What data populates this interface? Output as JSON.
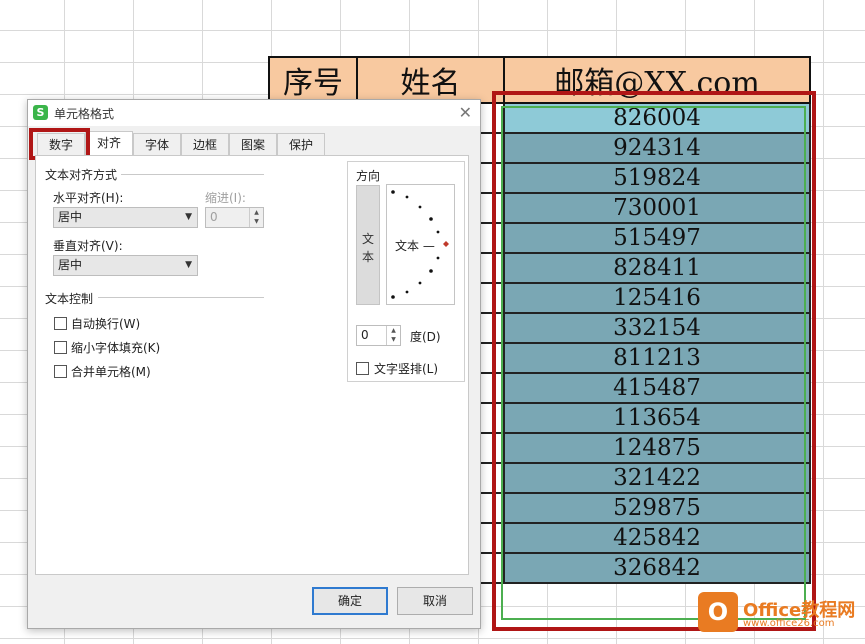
{
  "sheet": {
    "headers": [
      "序号",
      "姓名",
      "邮箱@XX.com"
    ],
    "emails": [
      "826004",
      "924314",
      "519824",
      "730001",
      "515497",
      "828411",
      "125416",
      "332154",
      "811213",
      "415487",
      "113654",
      "124875",
      "321422",
      "529875",
      "425842",
      "326842"
    ],
    "colors": {
      "header_fill": "#f8c9a0",
      "selected_fill": "#7aa7b4",
      "active_fill": "#8ecad7",
      "highlight_red": "#b01616",
      "selection_green": "#4caf50"
    }
  },
  "dialog": {
    "title": "单元格格式",
    "app_icon": "S",
    "tabs": [
      "数字",
      "对齐",
      "字体",
      "边框",
      "图案",
      "保护"
    ],
    "active_tab": "对齐",
    "alignment": {
      "section_label": "文本对齐方式",
      "horizontal_label": "水平对齐(H):",
      "horizontal_value": "居中",
      "indent_label": "缩进(I):",
      "indent_value": "0",
      "vertical_label": "垂直对齐(V):",
      "vertical_value": "居中"
    },
    "text_control": {
      "section_label": "文本控制",
      "options": [
        "自动换行(W)",
        "缩小字体填充(K)",
        "合并单元格(M)"
      ]
    },
    "orientation": {
      "label": "方向",
      "vertical_text": "文本",
      "dial_text": "文本 —",
      "degree_value": "0",
      "degree_label": "度(D)",
      "vertical_layout_label": "文字竖排(L)"
    },
    "ok_label": "确定",
    "cancel_label": "取消"
  },
  "watermark": {
    "text": "Office教程网",
    "url": "www.office26.com"
  }
}
